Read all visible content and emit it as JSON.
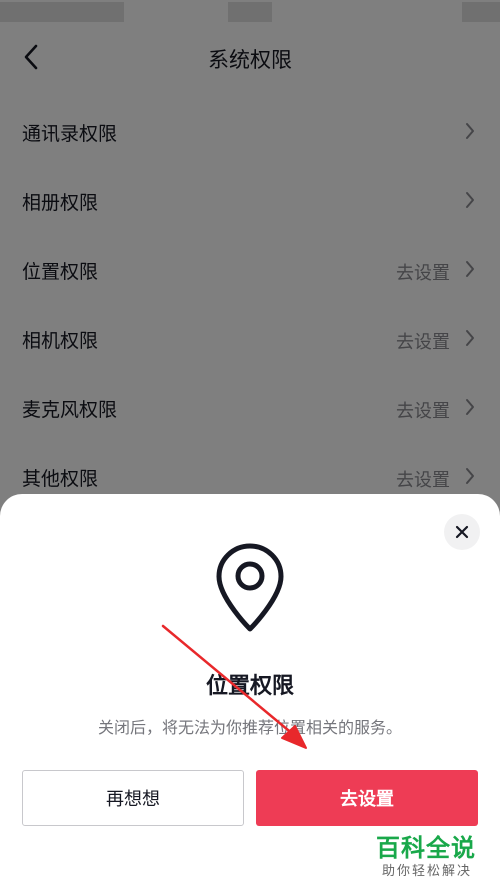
{
  "nav": {
    "title": "系统权限"
  },
  "permissions": [
    {
      "label": "通讯录权限",
      "value": ""
    },
    {
      "label": "相册权限",
      "value": ""
    },
    {
      "label": "位置权限",
      "value": "去设置"
    },
    {
      "label": "相机权限",
      "value": "去设置"
    },
    {
      "label": "麦克风权限",
      "value": "去设置"
    },
    {
      "label": "其他权限",
      "value": "去设置"
    }
  ],
  "dialog": {
    "title": "位置权限",
    "description": "关闭后，将无法为你推荐位置相关的服务。",
    "cancel_label": "再想想",
    "confirm_label": "去设置",
    "icon": "location-pin-icon"
  },
  "watermark": {
    "main": "百科全说",
    "sub": "助你轻松解决"
  },
  "colors": {
    "accent": "#ee3c55",
    "annotation_arrow": "#e8282b",
    "watermark": "#19a84a"
  }
}
